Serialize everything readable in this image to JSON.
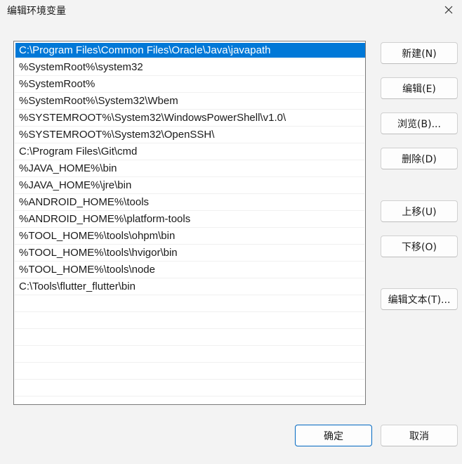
{
  "window": {
    "title": "编辑环境变量"
  },
  "icons": {
    "close": "close-icon"
  },
  "colors": {
    "selection": "#0078d7",
    "default_button_border": "#0067c0"
  },
  "paths": {
    "selected_index": 0,
    "items": [
      "C:\\Program Files\\Common Files\\Oracle\\Java\\javapath",
      "%SystemRoot%\\system32",
      "%SystemRoot%",
      "%SystemRoot%\\System32\\Wbem",
      "%SYSTEMROOT%\\System32\\WindowsPowerShell\\v1.0\\",
      "%SYSTEMROOT%\\System32\\OpenSSH\\",
      "C:\\Program Files\\Git\\cmd",
      "%JAVA_HOME%\\bin",
      "%JAVA_HOME%\\jre\\bin",
      "%ANDROID_HOME%\\tools",
      "%ANDROID_HOME%\\platform-tools",
      "%TOOL_HOME%\\tools\\ohpm\\bin",
      "%TOOL_HOME%\\tools\\hvigor\\bin",
      "%TOOL_HOME%\\tools\\node",
      "C:\\Tools\\flutter_flutter\\bin",
      "",
      "",
      "",
      "",
      "",
      ""
    ]
  },
  "buttons": {
    "new": "新建(N)",
    "edit": "编辑(E)",
    "browse": "浏览(B)...",
    "delete": "删除(D)",
    "move_up": "上移(U)",
    "move_down": "下移(O)",
    "edit_text": "编辑文本(T)...",
    "ok": "确定",
    "cancel": "取消"
  }
}
